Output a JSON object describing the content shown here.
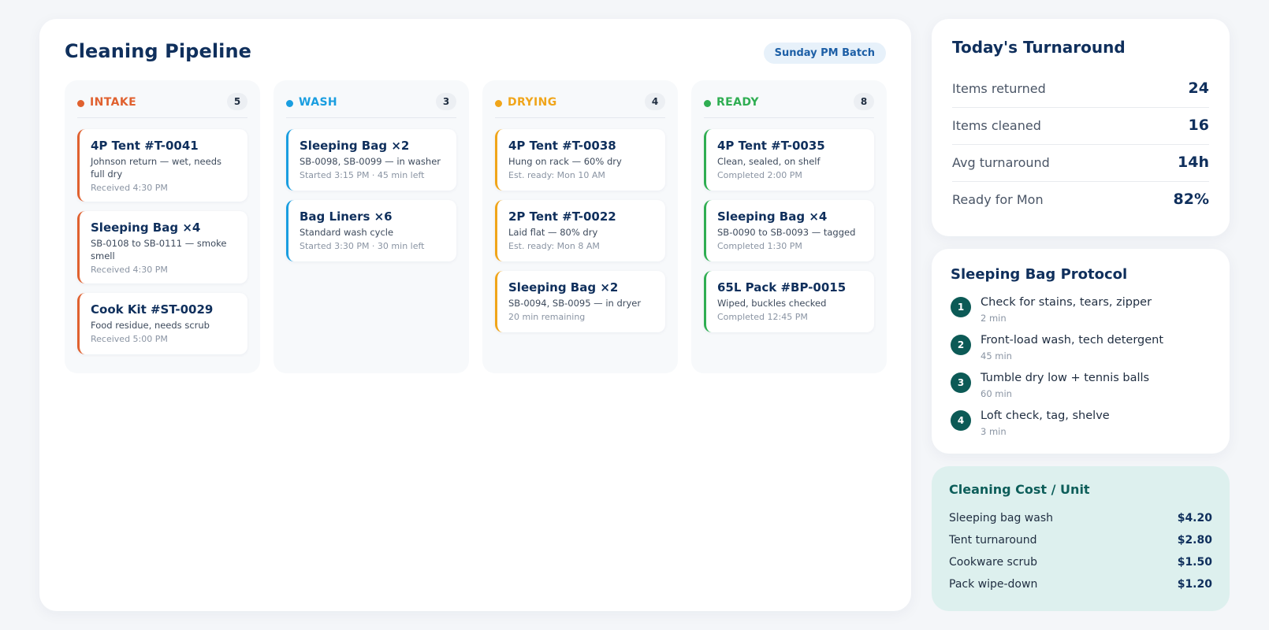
{
  "pipeline": {
    "title": "Cleaning Pipeline",
    "batch": "Sunday PM Batch",
    "columns": [
      {
        "name": "INTAKE",
        "count": "5",
        "color": "#e0612f",
        "cards": [
          {
            "title": "4P Tent #T-0041",
            "desc": "Johnson return — wet, needs full dry",
            "time": "Received 4:30 PM"
          },
          {
            "title": "Sleeping Bag ×4",
            "desc": "SB-0108 to SB-0111 — smoke smell",
            "time": "Received 4:30 PM"
          },
          {
            "title": "Cook Kit #ST-0029",
            "desc": "Food residue, needs scrub",
            "time": "Received 5:00 PM"
          }
        ]
      },
      {
        "name": "WASH",
        "count": "3",
        "color": "#1a9ee0",
        "cards": [
          {
            "title": "Sleeping Bag ×2",
            "desc": "SB-0098, SB-0099 — in washer",
            "time": "Started 3:15 PM · 45 min left"
          },
          {
            "title": "Bag Liners ×6",
            "desc": "Standard wash cycle",
            "time": "Started 3:30 PM · 30 min left"
          }
        ]
      },
      {
        "name": "DRYING",
        "count": "4",
        "color": "#f0a51a",
        "cards": [
          {
            "title": "4P Tent #T-0038",
            "desc": "Hung on rack — 60% dry",
            "time": "Est. ready: Mon 10 AM"
          },
          {
            "title": "2P Tent #T-0022",
            "desc": "Laid flat — 80% dry",
            "time": "Est. ready: Mon 8 AM"
          },
          {
            "title": "Sleeping Bag ×2",
            "desc": "SB-0094, SB-0095 — in dryer",
            "time": "20 min remaining"
          }
        ]
      },
      {
        "name": "READY",
        "count": "8",
        "color": "#2fae52",
        "cards": [
          {
            "title": "4P Tent #T-0035",
            "desc": "Clean, sealed, on shelf",
            "time": "Completed 2:00 PM"
          },
          {
            "title": "Sleeping Bag ×4",
            "desc": "SB-0090 to SB-0093 — tagged",
            "time": "Completed 1:30 PM"
          },
          {
            "title": "65L Pack #BP-0015",
            "desc": "Wiped, buckles checked",
            "time": "Completed 12:45 PM"
          }
        ]
      }
    ]
  },
  "turnaround": {
    "title": "Today's Turnaround",
    "stats": [
      {
        "label": "Items returned",
        "value": "24"
      },
      {
        "label": "Items cleaned",
        "value": "16"
      },
      {
        "label": "Avg turnaround",
        "value": "14h"
      },
      {
        "label": "Ready for Mon",
        "value": "82%"
      }
    ]
  },
  "protocol": {
    "title": "Sleeping Bag Protocol",
    "steps": [
      {
        "num": "1",
        "text": "Check for stains, tears, zipper",
        "dur": "2 min"
      },
      {
        "num": "2",
        "text": "Front-load wash, tech detergent",
        "dur": "45 min"
      },
      {
        "num": "3",
        "text": "Tumble dry low + tennis balls",
        "dur": "60 min"
      },
      {
        "num": "4",
        "text": "Loft check, tag, shelve",
        "dur": "3 min"
      }
    ]
  },
  "cost": {
    "title": "Cleaning Cost / Unit",
    "rows": [
      {
        "label": "Sleeping bag wash",
        "value": "$4.20"
      },
      {
        "label": "Tent turnaround",
        "value": "$2.80"
      },
      {
        "label": "Cookware scrub",
        "value": "$1.50"
      },
      {
        "label": "Pack wipe-down",
        "value": "$1.20"
      }
    ]
  }
}
